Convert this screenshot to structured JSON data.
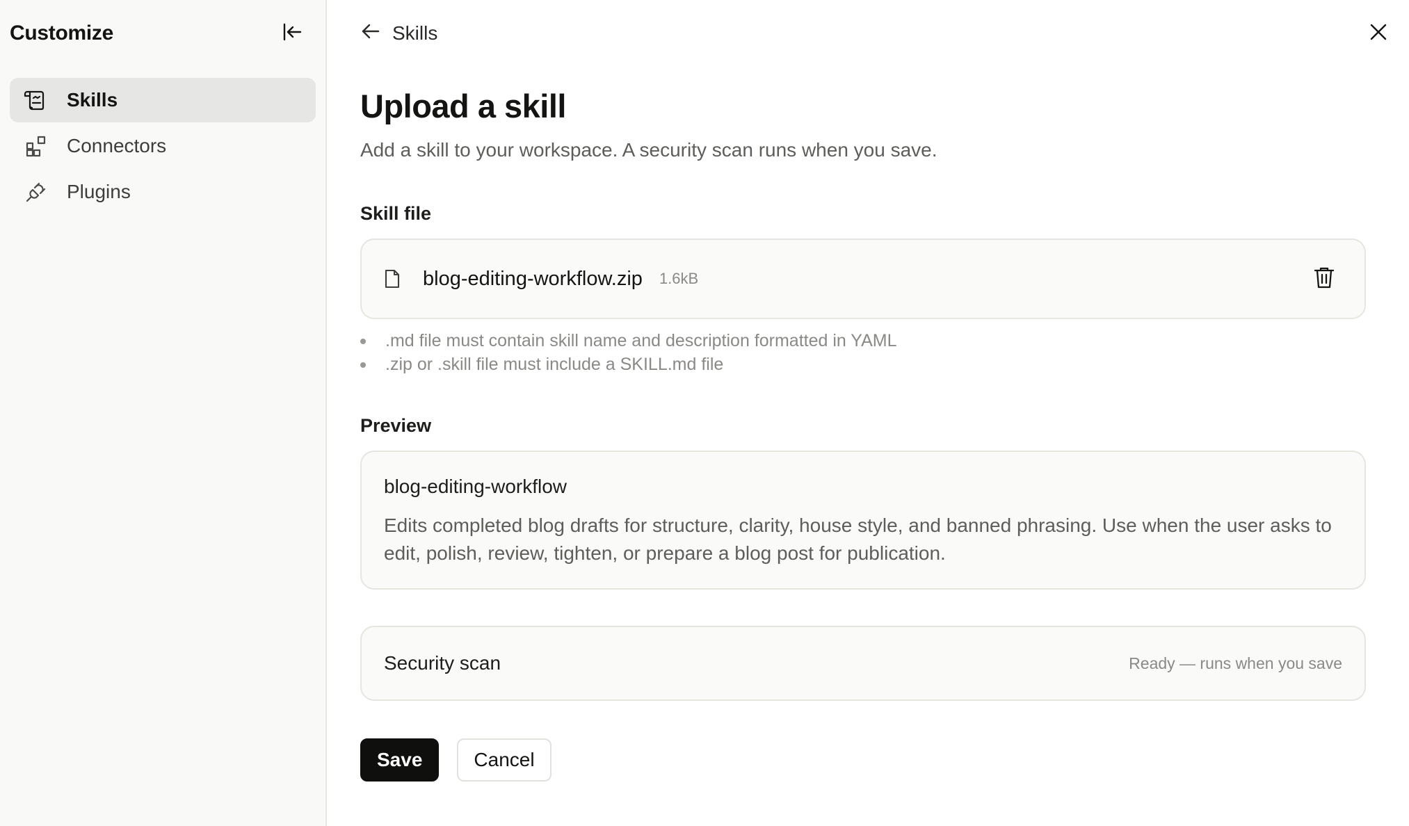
{
  "sidebar": {
    "title": "Customize",
    "collapse_icon": "collapse-sidebar-icon",
    "items": [
      {
        "label": "Skills",
        "icon": "skills-icon",
        "active": true
      },
      {
        "label": "Connectors",
        "icon": "connectors-icon",
        "active": false
      },
      {
        "label": "Plugins",
        "icon": "plugins-icon",
        "active": false
      }
    ]
  },
  "topbar": {
    "back_label": "Skills",
    "back_icon": "arrow-left-icon",
    "close_icon": "close-icon"
  },
  "main": {
    "title": "Upload a skill",
    "subtitle": "Add a skill to your workspace. A security scan runs when you save.",
    "skill_file": {
      "label": "Skill file",
      "file_name": "blog-editing-workflow.zip",
      "file_size": "1.6kB",
      "file_icon": "file-icon",
      "delete_icon": "trash-icon",
      "rules": [
        ".md file must contain skill name and description formatted in YAML",
        ".zip or .skill file must include a SKILL.md file"
      ]
    },
    "preview": {
      "label": "Preview",
      "name": "blog-editing-workflow",
      "description": "Edits completed blog drafts for structure, clarity, house style, and banned phrasing. Use when the user asks to edit, polish, review, tighten, or prepare a blog post for publication."
    },
    "security_scan": {
      "label": "Security scan",
      "status": "Ready — runs when you save"
    },
    "actions": {
      "save_label": "Save",
      "cancel_label": "Cancel"
    }
  },
  "colors": {
    "primary_button": "#0f0f0e",
    "active_nav_bg": "#e6e6e4",
    "muted_text": "#8a8985"
  }
}
